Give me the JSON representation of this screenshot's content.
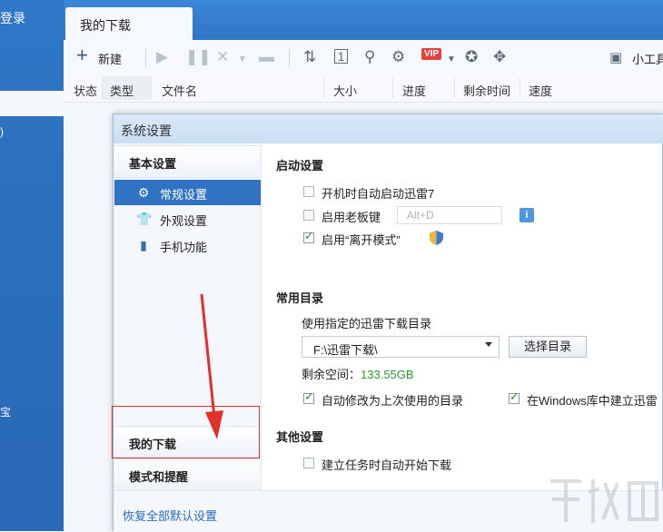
{
  "left_panel": {
    "login_text": "登录",
    "fragments": [
      ")",
      "宝"
    ]
  },
  "tabs": {
    "active": "我的下载"
  },
  "toolbar": {
    "new_label": "新建",
    "tools_label": "小工具",
    "vip_badge": "VIP"
  },
  "columns": [
    "状态",
    "类型",
    "文件名",
    "大小",
    "进度",
    "剩余时间",
    "速度"
  ],
  "dialog": {
    "title": "系统设置",
    "nav": {
      "basic_section": "基本设置",
      "items": [
        "常规设置",
        "外观设置",
        "手机功能"
      ],
      "my_download_section": "我的下载",
      "mode_section": "模式和提醒"
    },
    "startup": {
      "heading": "启动设置",
      "auto_start": {
        "label": "开机时自动启动迅雷7",
        "checked": false
      },
      "boss_key": {
        "label": "启用老板键",
        "checked": false,
        "hotkey_placeholder": "Alt+D"
      },
      "away_mode": {
        "label": "启用“离开模式”",
        "checked": true
      }
    },
    "directory": {
      "heading": "常用目录",
      "use_label": "使用指定的迅雷下载目录",
      "path": "F:\\迅雷下载\\",
      "choose_button": "选择目录",
      "free_label": "剩余空间：",
      "free_value": "133.55GB",
      "auto_modify": {
        "label": "自动修改为上次使用的目录",
        "checked": true
      },
      "windows_lib": {
        "label": "在Windows库中建立迅雷",
        "checked": true
      }
    },
    "other": {
      "heading": "其他设置",
      "auto_start_task": {
        "label": "建立任务时自动开始下载",
        "checked": false
      }
    },
    "restore_defaults": "恢复全部默认设置"
  },
  "colors": {
    "accent": "#2f73c2",
    "annotation": "#e0302a",
    "free_space": "#2e9a2e"
  }
}
